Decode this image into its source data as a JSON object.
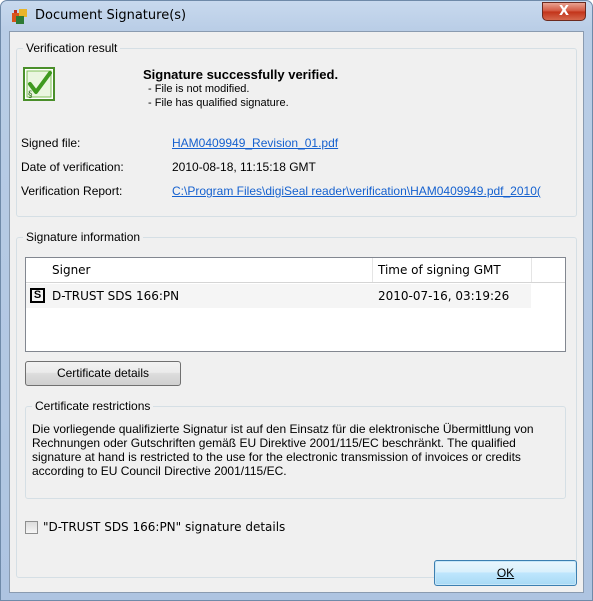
{
  "window": {
    "title": "Document Signature(s)",
    "close_glyph": "X"
  },
  "verification": {
    "group_label": "Verification result",
    "status_title": "Signature successfully verified.",
    "status_lines": [
      "- File is not modified.",
      "- File has qualified signature."
    ],
    "fields": [
      {
        "label": "Signed file:",
        "value": "HAM0409949_Revision_01.pdf"
      },
      {
        "label": "Date of verification:",
        "value": "2010-08-18, 11:15:18 GMT"
      },
      {
        "label": "Verification Report:",
        "value": "C:\\Program Files\\digiSeal reader\\verification\\HAM0409949.pdf_2010("
      }
    ]
  },
  "signature_info": {
    "group_label": "Signature information",
    "columns": [
      "Signer",
      "Time of signing GMT"
    ],
    "rows": [
      {
        "icon": "S",
        "signer": "D-TRUST SDS 166:PN",
        "time": "2010-07-16, 03:19:26"
      }
    ],
    "certificate_details_label": "Certificate details",
    "restrictions": {
      "group_label": "Certificate restrictions",
      "text": "Die vorliegende qualifizierte Signatur ist auf den Einsatz für die elektronische Übermittlung von Rechnungen oder Gutschriften gemäß EU Direktive 2001/115/EC beschränkt. The qualified signature at hand is restricted to the use for the electronic transmission of invoices or credits according to EU Council Directive 2001/115/EC."
    },
    "details_checkbox_label": "\"D-TRUST SDS 166:PN\" signature details",
    "details_checked": false
  },
  "footer": {
    "ok_label": "OK"
  },
  "colors": {
    "link": "#1561cf",
    "ok_icon": "#4caf24"
  }
}
